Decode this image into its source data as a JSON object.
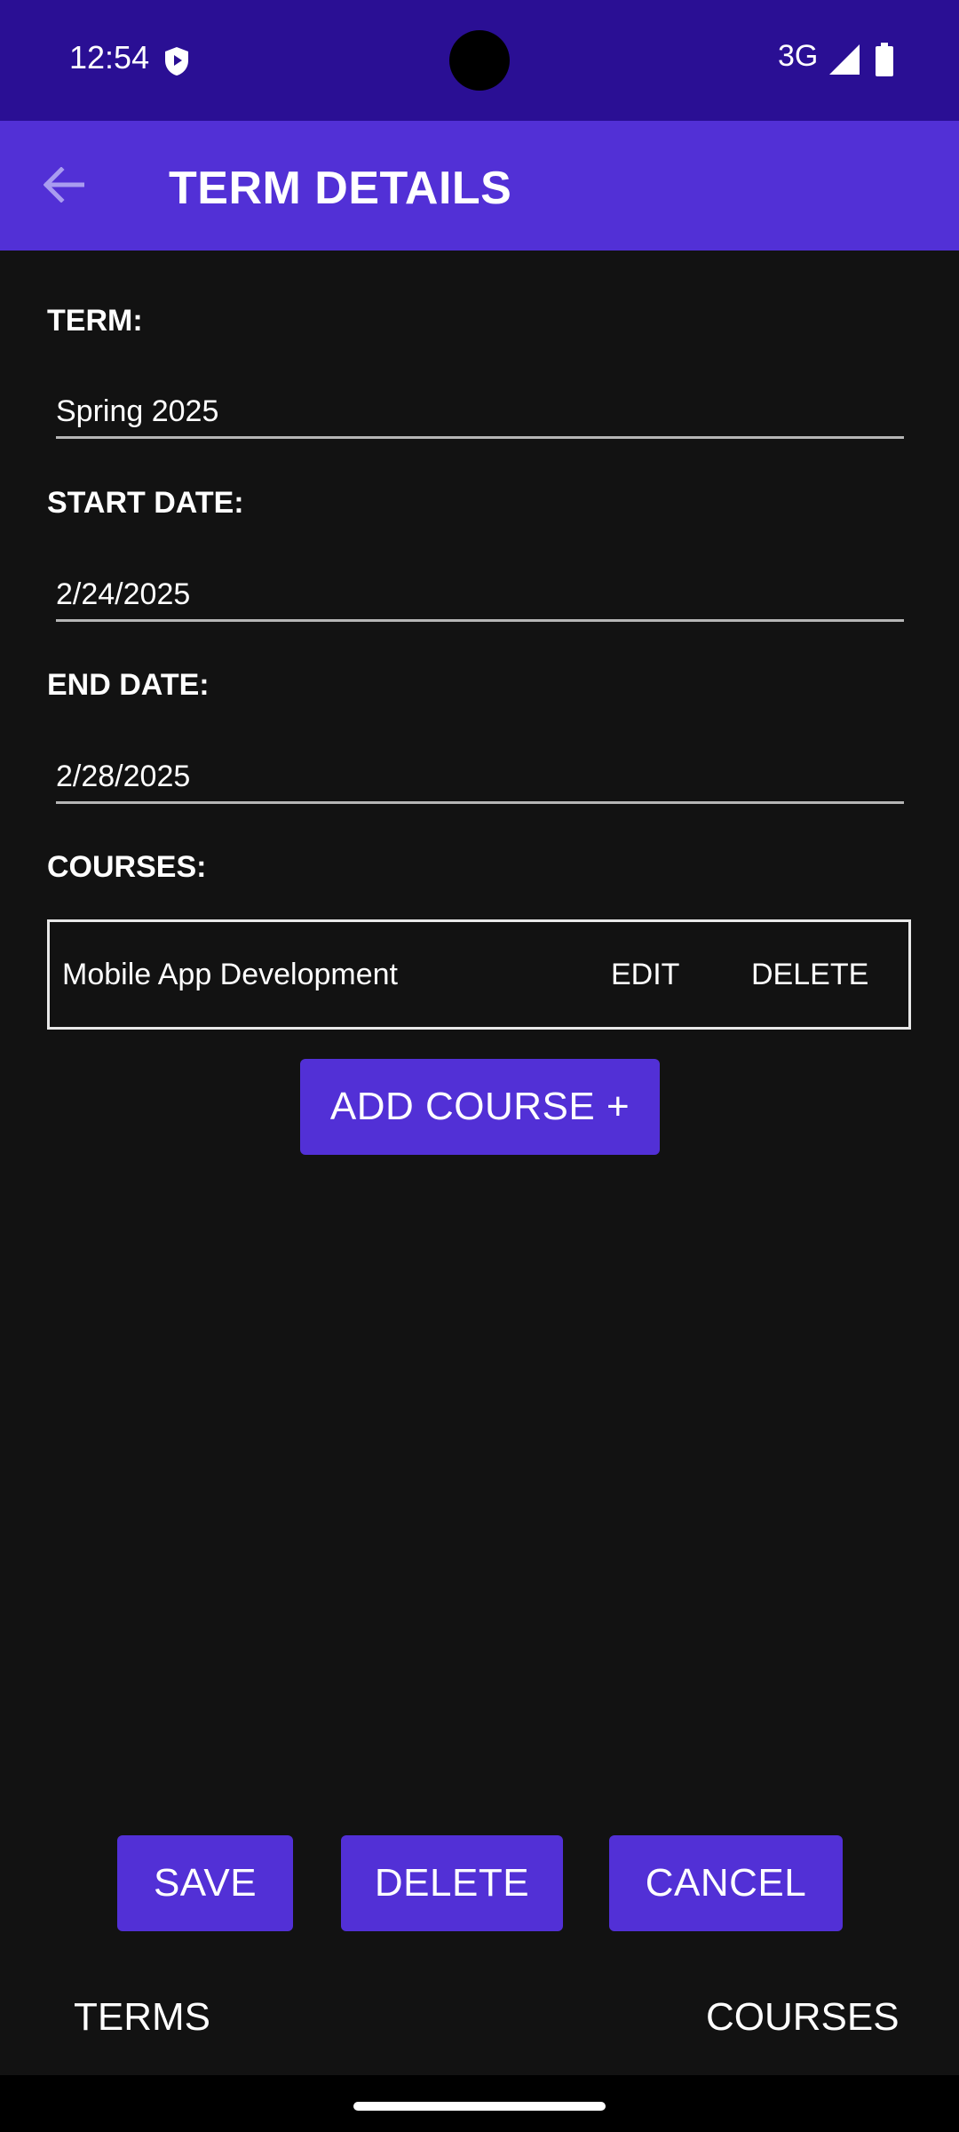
{
  "status_bar": {
    "time": "12:54",
    "network": "3G",
    "icons": [
      "shield-icon",
      "signal-icon",
      "battery-icon"
    ]
  },
  "app_bar": {
    "title": "TERM DETAILS",
    "back_icon": "arrow-back-icon"
  },
  "form": {
    "term_label": "TERM:",
    "term_value": "Spring 2025",
    "start_label": "START DATE:",
    "start_value": "2/24/2025",
    "end_label": "END DATE:",
    "end_value": "2/28/2025",
    "courses_label": "COURSES:"
  },
  "courses": [
    {
      "name": "Mobile App Development",
      "edit_label": "EDIT",
      "delete_label": "DELETE"
    }
  ],
  "buttons": {
    "add_course": "ADD COURSE +",
    "save": "SAVE",
    "delete": "DELETE",
    "cancel": "CANCEL"
  },
  "bottom_nav": {
    "terms": "TERMS",
    "courses": "COURSES"
  },
  "colors": {
    "status_bar": "#2a0f94",
    "app_bar": "#5230d6",
    "button": "#5230d6",
    "background": "#121212"
  }
}
